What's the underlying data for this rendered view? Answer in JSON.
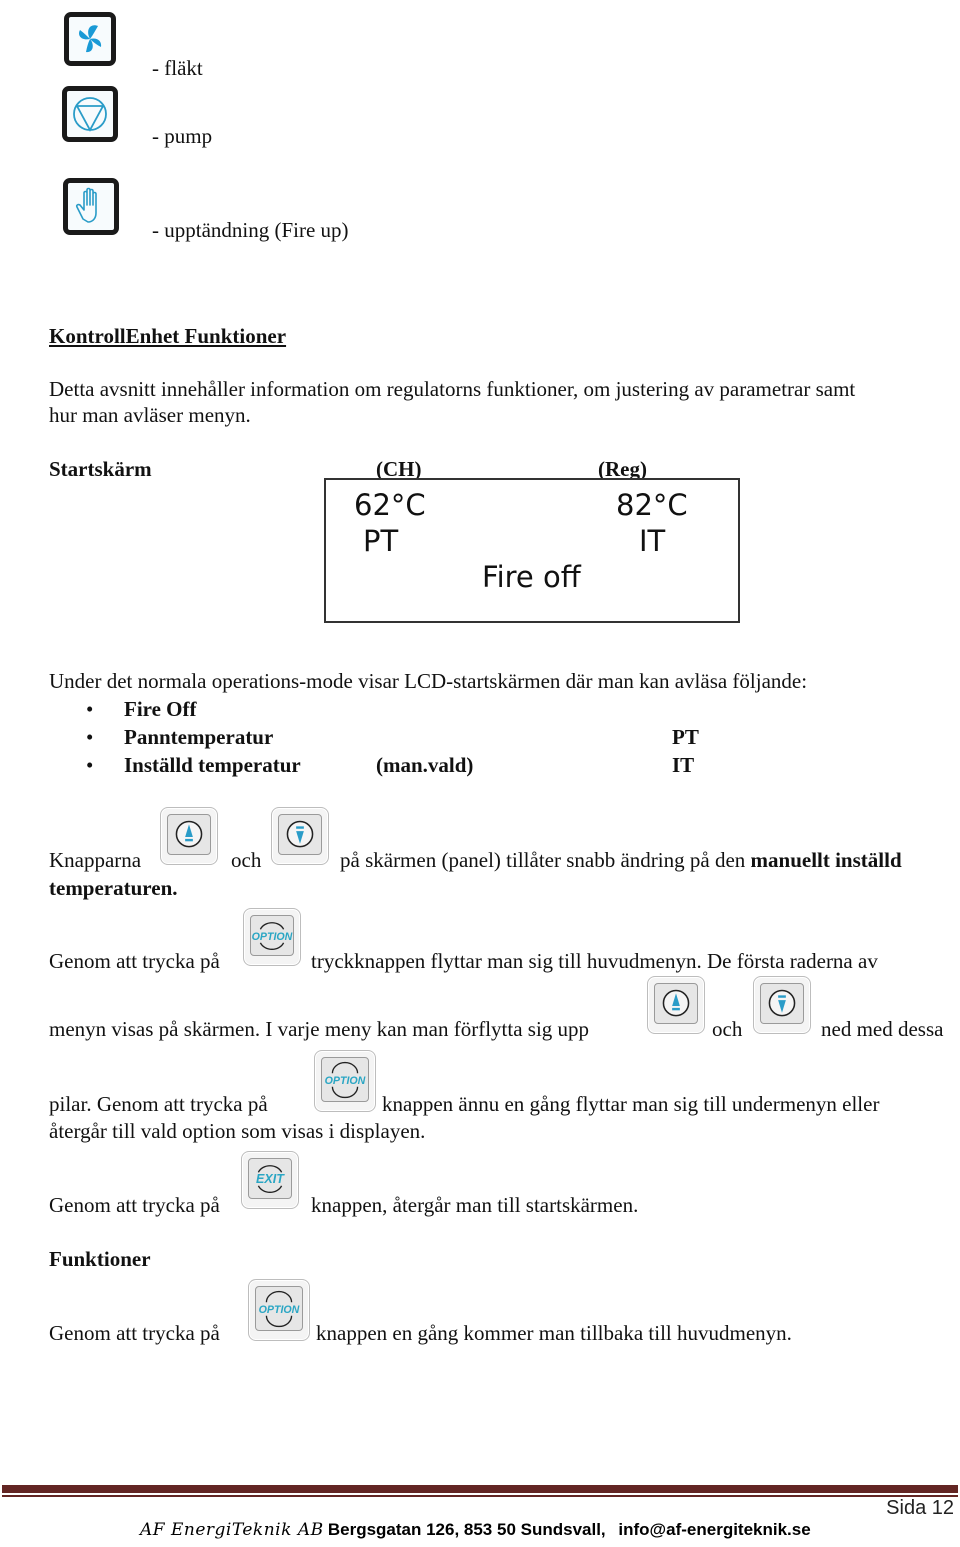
{
  "legend": {
    "items": [
      {
        "icon": "fan-icon",
        "label": "- fläkt"
      },
      {
        "icon": "pump-icon",
        "label": "- pump"
      },
      {
        "icon": "hand-icon",
        "label": "- upptändning (Fire up)"
      }
    ]
  },
  "section": {
    "title": "KontrollEnhet Funktioner",
    "intro_line1": "Detta avsnitt innehåller information om regulatorns funktioner, om justering av parametrar samt",
    "intro_line2": "hur man avläser menyn."
  },
  "start_screen": {
    "label": "Startskärm",
    "ch_label": "(CH)",
    "reg_label": "(Reg)",
    "lcd": {
      "left_temp": "62°C",
      "right_temp": "82°C",
      "left_code": "PT",
      "right_code": "IT",
      "status": "Fire off"
    }
  },
  "normal_mode": {
    "text": "Under det normala operations-mode visar LCD-startskärmen där man kan avläsa följande:",
    "bullets": [
      {
        "label": "Fire Off",
        "note": "",
        "code": ""
      },
      {
        "label": "Panntemperatur",
        "note": "",
        "code": "PT"
      },
      {
        "label": "Inställd temperatur",
        "note": "(man.vald)",
        "code": "IT"
      }
    ]
  },
  "paragraphs": {
    "p1_a": "Knapparna",
    "p1_b": "och",
    "p1_c": "på skärmen (panel) tillåter snabb ändring på den",
    "p1_bold1": "manuellt inställd",
    "p1_bold2": "temperaturen.",
    "p2_a": "Genom att trycka på",
    "p2_b": "tryckknappen flyttar man sig till huvudmenyn. De första raderna av",
    "p3_a": "menyn visas på skärmen. I varje meny kan man förflytta sig upp",
    "p3_b": "och",
    "p3_c": "ned med dessa",
    "p4_a": "pilar.  Genom att trycka på",
    "p4_b": "knappen ännu en gång flyttar man sig till undermenyn eller",
    "p4_c": "återgår till vald option som visas i displayen.",
    "p5_a": "Genom att trycka på",
    "p5_b": "knappen, återgår man till startskärmen.",
    "funktioner_heading": "Funktioner",
    "p6_a": "Genom att trycka på",
    "p6_b": "knappen en gång kommer man tillbaka till huvudmenyn."
  },
  "buttons": {
    "option_label": "OPTION",
    "exit_label": "EXIT"
  },
  "footer": {
    "page": "Sida 12",
    "company": "AF EnergiTeknik AB",
    "address": "Bergsgatan 126, 853 50 Sundsvall,",
    "email": "info@af-energiteknik.se"
  },
  "colors": {
    "icon_blue": "#1a9ad6",
    "button_text_teal": "#2aa6c4",
    "footer_rule": "#632523"
  }
}
